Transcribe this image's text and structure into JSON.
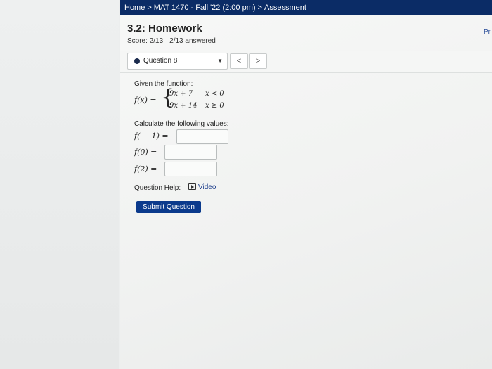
{
  "breadcrumb": {
    "home": "Home",
    "separator": ">",
    "course": "MAT 1470 - Fall '22 (2:00 pm)",
    "current": "Assessment"
  },
  "corner_text": "Pr",
  "homework": {
    "title": "3.2: Homework",
    "score": "Score: 2/13",
    "answered": "2/13 answered"
  },
  "question_nav": {
    "selected": "Question 8",
    "prev_label": "<",
    "next_label": ">"
  },
  "problem": {
    "intro": "Given the function:",
    "function_label": "f(x) =",
    "pieces": [
      {
        "expression": "9x + 7",
        "condition": "x < 0"
      },
      {
        "expression": "9x + 14",
        "condition": "x ≥ 0"
      }
    ],
    "instruction": "Calculate the following values:",
    "parts": [
      {
        "label": "f( − 1) =",
        "value": ""
      },
      {
        "label": "f(0) =",
        "value": ""
      },
      {
        "label": "f(2) =",
        "value": ""
      }
    ]
  },
  "help": {
    "label": "Question Help:",
    "video_label": "Video"
  },
  "submit_label": "Submit Question"
}
